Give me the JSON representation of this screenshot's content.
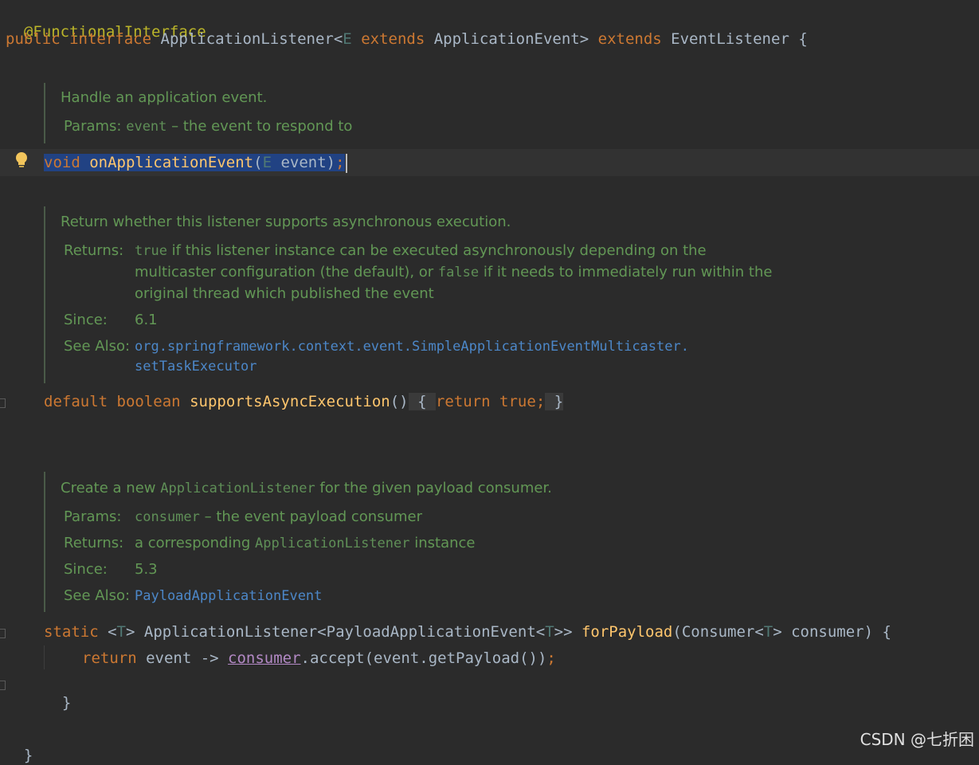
{
  "code": {
    "annotation": "@FunctionalInterface",
    "decl": {
      "kw_public": "public",
      "kw_interface": "interface",
      "name": "ApplicationListener<",
      "type_param": "E",
      "kw_extends": "extends",
      "bound": "ApplicationEvent>",
      "kw_extends2": "extends",
      "iface": "EventListener {"
    },
    "method1": {
      "kw_void": "void",
      "name": "onApplicationEvent",
      "open": "(",
      "type_param": "E",
      "param": " event)",
      "semi": ";"
    },
    "method2": {
      "kw_default": "default",
      "kw_boolean": "boolean",
      "name": "supportsAsyncExecution",
      "parens": "()",
      "fold_open": " { ",
      "kw_return": "return",
      "kw_true": "true",
      "semi": ";",
      "fold_close": " }"
    },
    "method3": {
      "kw_static": "static",
      "tp_open": "<",
      "tp": "T",
      "tp_close": "> ApplicationListener<PayloadApplicationEvent<",
      "tp2": "T",
      "tp2_close": ">> ",
      "name": "forPayload",
      "args_open": "(Consumer<",
      "tp3": "T",
      "args_close": "> consumer) {",
      "kw_return": "return",
      "body1": " event -> ",
      "var": "consumer",
      "body2": ".accept(event.getPayload())",
      "semi": ";",
      "close": "}"
    },
    "end": "}"
  },
  "doc1": {
    "summary": "Handle an application event.",
    "params_label": "Params:",
    "param_name": "event",
    "param_desc": " – the event to respond to"
  },
  "doc2": {
    "summary": "Return whether this listener supports asynchronous execution.",
    "returns_label": "Returns:",
    "r_true": "true",
    "r_line1": " if this listener instance can be executed asynchronously depending on the",
    "r_line2a": "multicaster configuration (the default), or ",
    "r_false": "false",
    "r_line2b": " if it needs to immediately run within the",
    "r_line3": "original thread which published the event",
    "since_label": "Since:",
    "since": "6.1",
    "see_label": "See Also:",
    "see1": "org.springframework.context.event.SimpleApplicationEventMulticaster.",
    "see2": "setTaskExecutor"
  },
  "doc3": {
    "summary_a": "Create a new ",
    "summary_code": "ApplicationListener",
    "summary_b": " for the given payload consumer.",
    "params_label": "Params:",
    "param_name": "consumer",
    "param_desc": " – the event payload consumer",
    "returns_label": "Returns:",
    "ret_a": "a corresponding ",
    "ret_code": "ApplicationListener",
    "ret_b": " instance",
    "since_label": "Since:",
    "since": "5.3",
    "see_label": "See Also:",
    "see": "PayloadApplicationEvent"
  },
  "watermark": "CSDN @七折困",
  "colors": {
    "background": "#2b2b2b",
    "keyword": "#cc7832",
    "function": "#ffc66d",
    "doc": "#629755",
    "link": "#4c87c8",
    "selection": "#214283"
  }
}
